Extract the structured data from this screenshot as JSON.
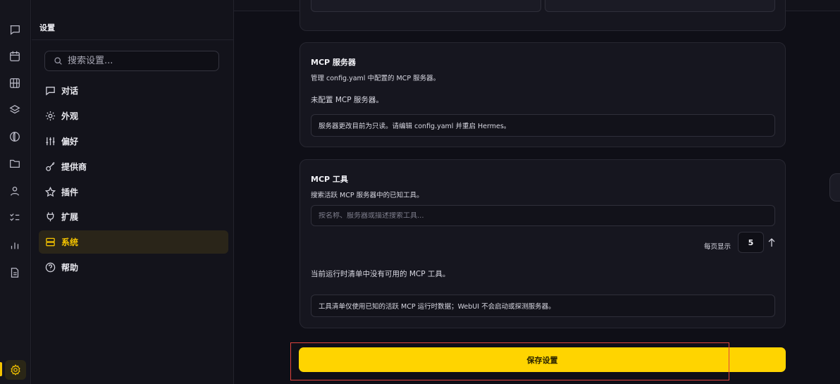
{
  "window": {
    "title": "设置"
  },
  "rail": {
    "icons": [
      "chat-icon",
      "calendar-icon",
      "grid-icon",
      "layers-icon",
      "globe-icon",
      "folder-icon",
      "user-icon",
      "checklist-icon",
      "bar-chart-icon",
      "document-icon"
    ],
    "active_icon": "gear-icon"
  },
  "sidebar": {
    "title": "设置",
    "search_placeholder": "搜索设置...",
    "items": [
      {
        "label": "对话",
        "icon": "chat-icon"
      },
      {
        "label": "外观",
        "icon": "sun-icon"
      },
      {
        "label": "偏好",
        "icon": "sliders-icon"
      },
      {
        "label": "提供商",
        "icon": "key-icon"
      },
      {
        "label": "插件",
        "icon": "star-icon"
      },
      {
        "label": "扩展",
        "icon": "plug-icon"
      },
      {
        "label": "系统",
        "icon": "server-icon",
        "active": true
      },
      {
        "label": "帮助",
        "icon": "help-icon"
      }
    ]
  },
  "mcp_servers": {
    "title": "MCP 服务器",
    "subtitle": "管理 config.yaml 中配置的 MCP 服务器。",
    "empty_text": "未配置 MCP 服务器。",
    "note": "服务器更改目前为只读。请编辑 config.yaml 并重启 Hermes。"
  },
  "mcp_tools": {
    "title": "MCP 工具",
    "subtitle": "搜索活跃 MCP 服务器中的已知工具。",
    "search_placeholder": "按名称、服务器或描述搜索工具...",
    "per_page_label": "每页显示",
    "per_page_value": "5",
    "empty_text": "当前运行时清单中没有可用的 MCP 工具。",
    "note": "工具清单仅使用已知的活跃 MCP 运行时数据；WebUI 不会启动或探测服务器。"
  },
  "footer": {
    "save_label": "保存设置"
  },
  "colors": {
    "accent": "#ffd400",
    "highlight": "#e0443e",
    "background": "#0f0f17"
  }
}
